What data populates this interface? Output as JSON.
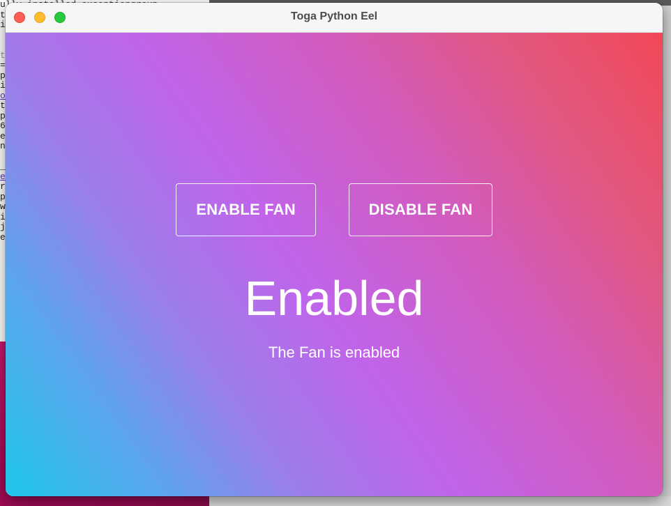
{
  "window": {
    "title": "Toga Python Eel"
  },
  "controls": {
    "enable_label": "ENABLE FAN",
    "disable_label": "DISABLE FAN"
  },
  "status": {
    "heading": "Enabled",
    "message": "The Fan is enabled"
  },
  "background_terminal": {
    "lines": [
      "ully installed exceptiongroup",
      "t",
      "i",
      "",
      "t",
      "=",
      "p",
      "i",
      "o",
      "t",
      "p",
      "6",
      "e",
      "n",
      "_",
      "e",
      "r",
      "p",
      "w",
      "i",
      "j",
      "e"
    ]
  },
  "colors": {
    "gradient_start": "#1ec8ea",
    "gradient_mid": "#c064ea",
    "gradient_end": "#f24858",
    "close": "#ff5f57",
    "minimize": "#febc2e",
    "zoom": "#28c840"
  }
}
